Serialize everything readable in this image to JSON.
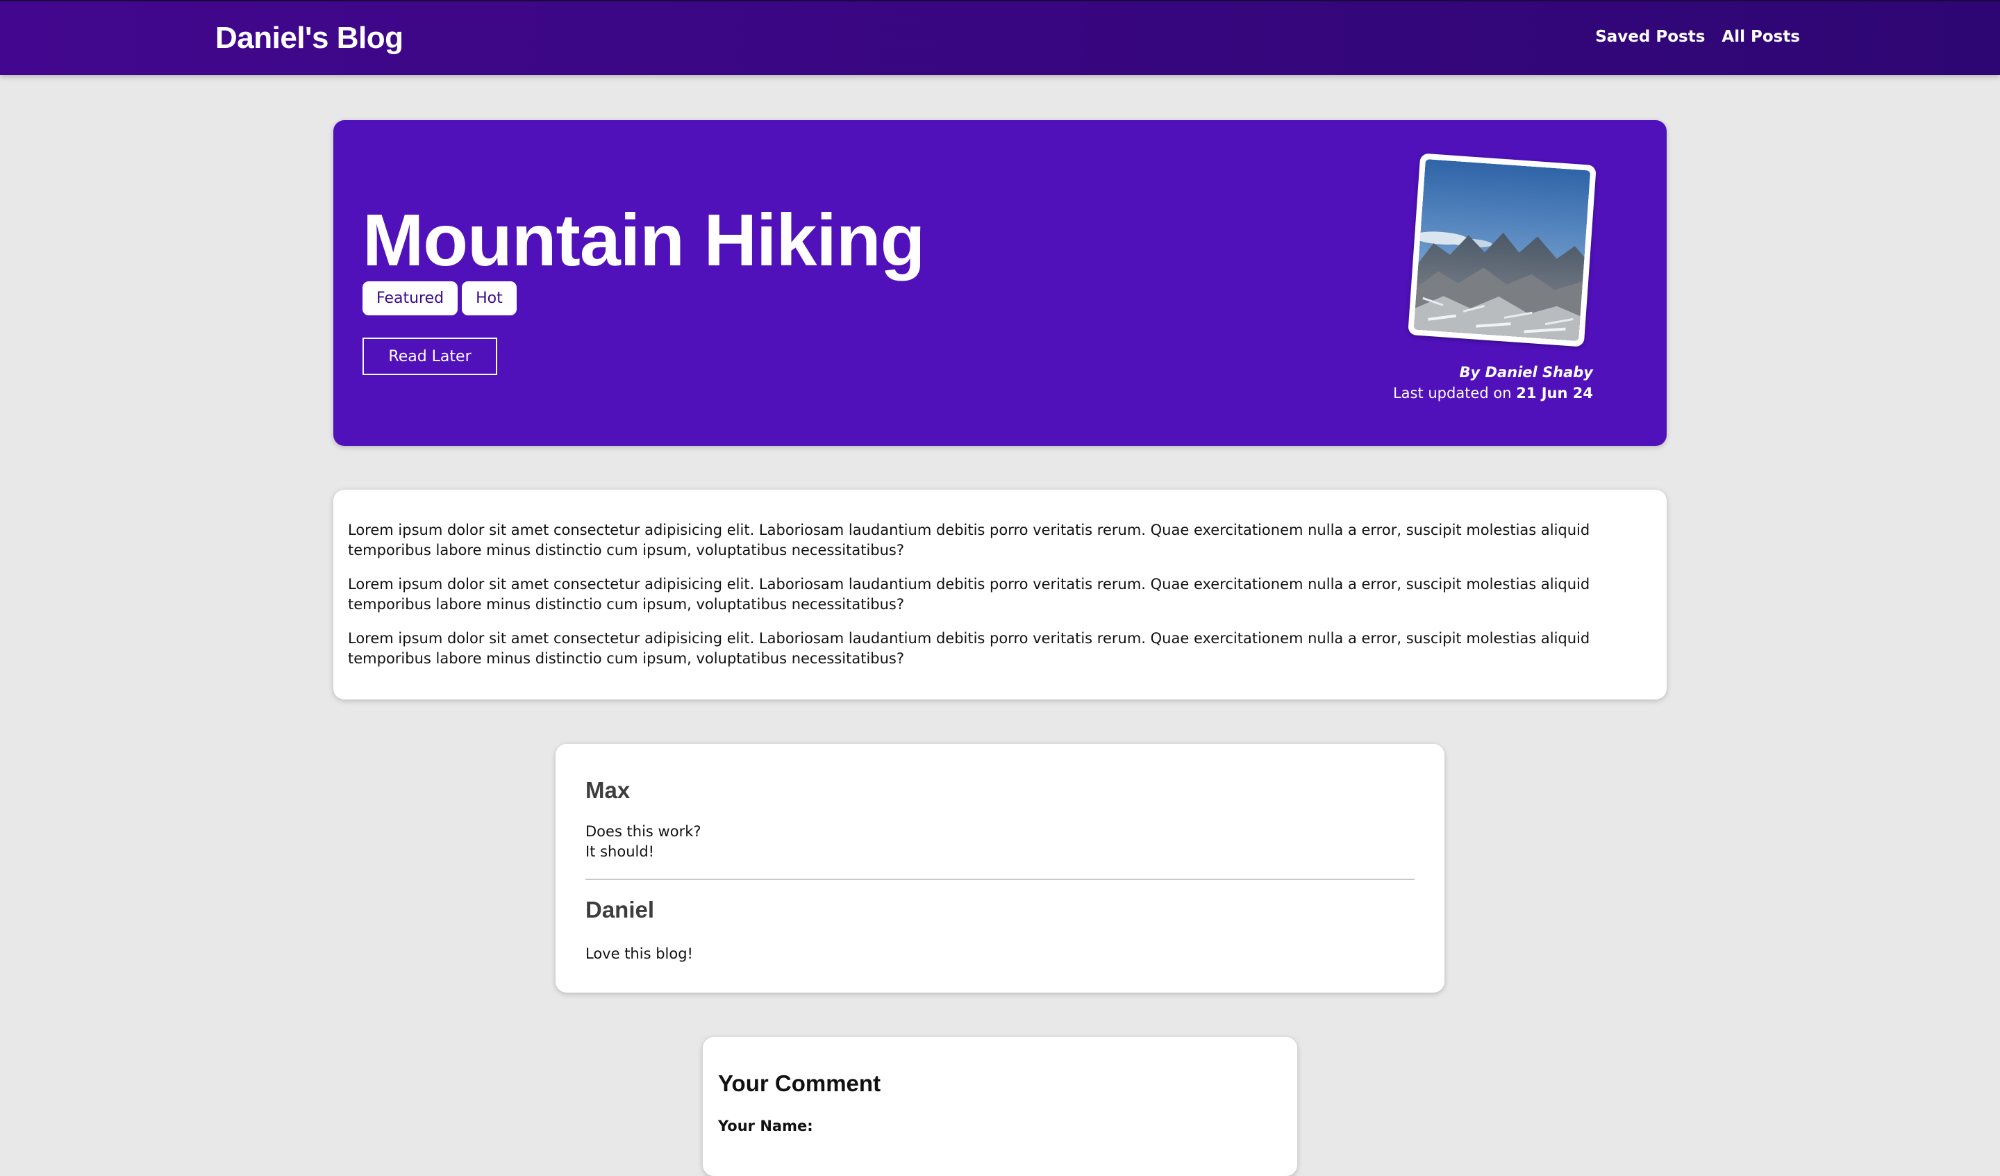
{
  "navbar": {
    "brand": "Daniel's Blog",
    "links": [
      "Saved Posts",
      "All Posts"
    ]
  },
  "post": {
    "title": "Mountain Hiking",
    "tags": [
      "Featured",
      "Hot"
    ],
    "read_later_label": "Read Later",
    "author": "By Daniel Shaby",
    "updated_prefix": "Last updated on",
    "updated_date": "21 Jun 24",
    "paragraphs": [
      "Lorem ipsum dolor sit amet consectetur adipisicing elit. Laboriosam laudantium debitis porro veritatis rerum. Quae exercitationem nulla a error, suscipit molestias aliquid temporibus labore minus distinctio cum ipsum, voluptatibus necessitatibus?",
      "Lorem ipsum dolor sit amet consectetur adipisicing elit. Laboriosam laudantium debitis porro veritatis rerum. Quae exercitationem nulla a error, suscipit molestias aliquid temporibus labore minus distinctio cum ipsum, voluptatibus necessitatibus?",
      "Lorem ipsum dolor sit amet consectetur adipisicing elit. Laboriosam laudantium debitis porro veritatis rerum. Quae exercitationem nulla a error, suscipit molestias aliquid temporibus labore minus distinctio cum ipsum, voluptatibus necessitatibus?"
    ]
  },
  "comments": [
    {
      "author": "Max",
      "text": "Does this work?\nIt should!"
    },
    {
      "author": "Daniel",
      "text": "Love this blog!"
    }
  ],
  "comment_form": {
    "title": "Your Comment",
    "name_label": "Your Name:"
  },
  "colors": {
    "navbar": "#3a0780",
    "hero": "#5010ba",
    "background": "#e8e8e8"
  }
}
